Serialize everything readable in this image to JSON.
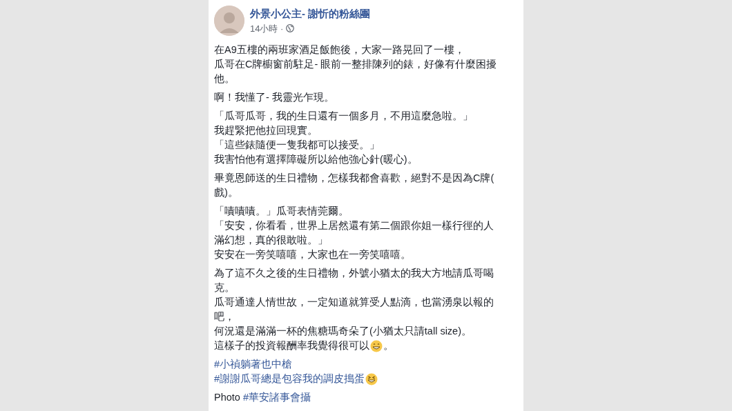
{
  "post": {
    "page_name": "外景小公主- 謝忻的粉絲團",
    "time": "14小時 ·",
    "paragraphs": [
      {
        "lines": [
          [
            {
              "kind": "text",
              "text": "在A9五樓的兩班家酒足飯飽後，大家一路晃回了一樓，"
            }
          ],
          [
            {
              "kind": "text",
              "text": "瓜哥在C牌櫥窗前駐足- 眼前一整排陳列的錶，好像有什麼困擾"
            }
          ],
          [
            {
              "kind": "text",
              "text": "他。"
            }
          ]
        ]
      },
      {
        "lines": [
          [
            {
              "kind": "text",
              "text": "啊！我懂了- 我靈光乍現。"
            }
          ]
        ]
      },
      {
        "lines": [
          [
            {
              "kind": "text",
              "text": "「瓜哥瓜哥，我的生日還有一個多月，不用這麼急啦。」"
            }
          ],
          [
            {
              "kind": "text",
              "text": "我趕緊把他拉回現實。"
            }
          ],
          [
            {
              "kind": "text",
              "text": "「這些錶隨便一隻我都可以接受。」"
            }
          ],
          [
            {
              "kind": "text",
              "text": "我害怕他有選擇障礙所以給他強心針(暖心)。"
            }
          ]
        ]
      },
      {
        "lines": [
          [
            {
              "kind": "text",
              "text": "畢竟恩師送的生日禮物，怎樣我都會喜歡，絕對不是因為C牌("
            }
          ],
          [
            {
              "kind": "text",
              "text": "戲)。"
            }
          ]
        ]
      },
      {
        "lines": [
          [
            {
              "kind": "text",
              "text": "「嘖嘖嘖。」瓜哥表情莞爾。"
            }
          ],
          [
            {
              "kind": "text",
              "text": "「安安，你看看，世界上居然還有第二個跟你姐一樣行徑的人"
            }
          ],
          [
            {
              "kind": "text",
              "text": "滿幻想，真的很敢啦。」"
            }
          ],
          [
            {
              "kind": "text",
              "text": "安安在一旁笑嘻嘻，大家也在一旁笑嘻嘻。"
            }
          ]
        ]
      },
      {
        "lines": [
          [
            {
              "kind": "text",
              "text": "為了這不久之後的生日禮物，外號小猶太的我大方地請瓜哥喝"
            }
          ],
          [
            {
              "kind": "text",
              "text": "克。"
            }
          ],
          [
            {
              "kind": "text",
              "text": "瓜哥通達人情世故，一定知道就算受人點滴，也當湧泉以報的"
            }
          ],
          [
            {
              "kind": "text",
              "text": "吧，"
            }
          ],
          [
            {
              "kind": "text",
              "text": "何況還是滿滿一杯的焦糖瑪奇朵了(小猶太只請tall size)。"
            }
          ],
          [
            {
              "kind": "text",
              "text": "這樣子的投資報酬率我覺得很可以"
            },
            {
              "kind": "grin"
            },
            {
              "kind": "text",
              "text": "。"
            }
          ]
        ]
      },
      {
        "lines": [
          [
            {
              "kind": "hashtag",
              "text": "#小禎躺著也中槍"
            }
          ],
          [
            {
              "kind": "hashtag",
              "text": "#謝謝瓜哥總是包容我的調皮搗蛋"
            },
            {
              "kind": "laugh"
            }
          ]
        ]
      },
      {
        "lines": [
          [
            {
              "kind": "text",
              "text": "Photo"
            },
            {
              "kind": "hashtag",
              "text": "#華安諸事會攝"
            }
          ]
        ]
      }
    ]
  }
}
